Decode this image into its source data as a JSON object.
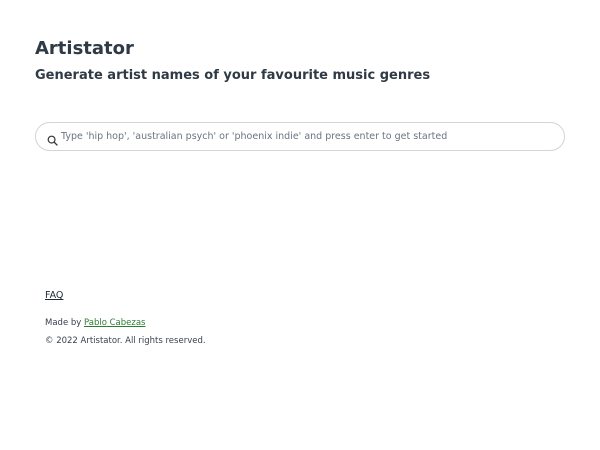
{
  "header": {
    "title": "Artistator",
    "subtitle": "Generate artist names of your favourite music genres"
  },
  "search": {
    "placeholder": "Type 'hip hop', 'australian psych' or 'phoenix indie' and press enter to get started",
    "value": "",
    "icon": "search-icon"
  },
  "footer": {
    "faq_label": "FAQ",
    "made_by_prefix": "Made by ",
    "author_name": "Pablo Cabezas",
    "copyright": "© 2022 Artistator. All rights reserved."
  },
  "colors": {
    "text": "#2f3a45",
    "link_author": "#2e7d32",
    "input_border": "#cfd5db"
  }
}
